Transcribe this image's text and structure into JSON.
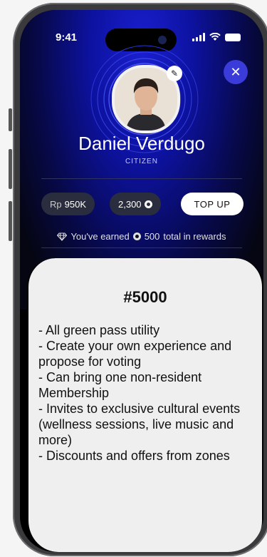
{
  "status": {
    "time": "9:41"
  },
  "profile": {
    "name": "Daniel Verdugo",
    "role": "CITIZEN"
  },
  "close_icon": "close-icon",
  "wallet": {
    "balance_prefix": "Rp",
    "balance_value": "950K",
    "points": "2,300",
    "topup_label": "TOP UP"
  },
  "rewards": {
    "prefix": "You've earned",
    "amount": "500",
    "suffix": "total in rewards"
  },
  "pass": {
    "title": "#5000",
    "benefits_text": "- All green pass utility\n- Create your own experience and propose for voting\n- Can bring one non-resident Membership\n- Invites to exclusive cultural events (wellness sessions, live music and more)\n- Discounts and offers from zones"
  },
  "colors": {
    "accent_blue": "#1a1fd0",
    "card_bg": "#efefef",
    "pill_bg": "#2a2d3d"
  }
}
